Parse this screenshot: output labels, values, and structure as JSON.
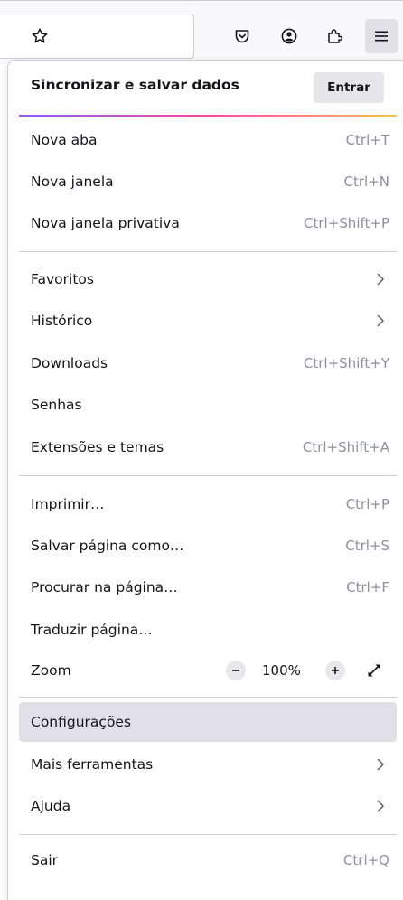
{
  "toolbar": {
    "icons": [
      "star-icon",
      "pocket-icon",
      "account-icon",
      "extensions-icon",
      "hamburger-menu-icon"
    ]
  },
  "menu": {
    "sync": {
      "title": "Sincronizar e salvar dados",
      "signin_label": "Entrar"
    },
    "items": [
      {
        "label": "Nova aba",
        "shortcut": "Ctrl+T"
      },
      {
        "label": "Nova janela",
        "shortcut": "Ctrl+N"
      },
      {
        "label": "Nova janela privativa",
        "shortcut": "Ctrl+Shift+P"
      },
      {
        "label": "Favoritos",
        "submenu": true
      },
      {
        "label": "Histórico",
        "submenu": true
      },
      {
        "label": "Downloads",
        "shortcut": "Ctrl+Shift+Y"
      },
      {
        "label": "Senhas"
      },
      {
        "label": "Extensões e temas",
        "shortcut": "Ctrl+Shift+A"
      },
      {
        "label": "Imprimir…",
        "shortcut": "Ctrl+P"
      },
      {
        "label": "Salvar página como…",
        "shortcut": "Ctrl+S"
      },
      {
        "label": "Procurar na página…",
        "shortcut": "Ctrl+F"
      },
      {
        "label": "Traduzir página…"
      },
      {
        "label": "Zoom",
        "value": "100%"
      },
      {
        "label": "Configurações",
        "selected": true
      },
      {
        "label": "Mais ferramentas",
        "submenu": true
      },
      {
        "label": "Ajuda",
        "submenu": true
      },
      {
        "label": "Sair",
        "shortcut": "Ctrl+Q"
      }
    ]
  },
  "colors": {
    "selected_background": "#e0e0e6",
    "shortcut_text": "#8f8f9d",
    "sync_gradient": [
      "#9059ff",
      "#ff4aa2",
      "#ffbd4f"
    ]
  }
}
